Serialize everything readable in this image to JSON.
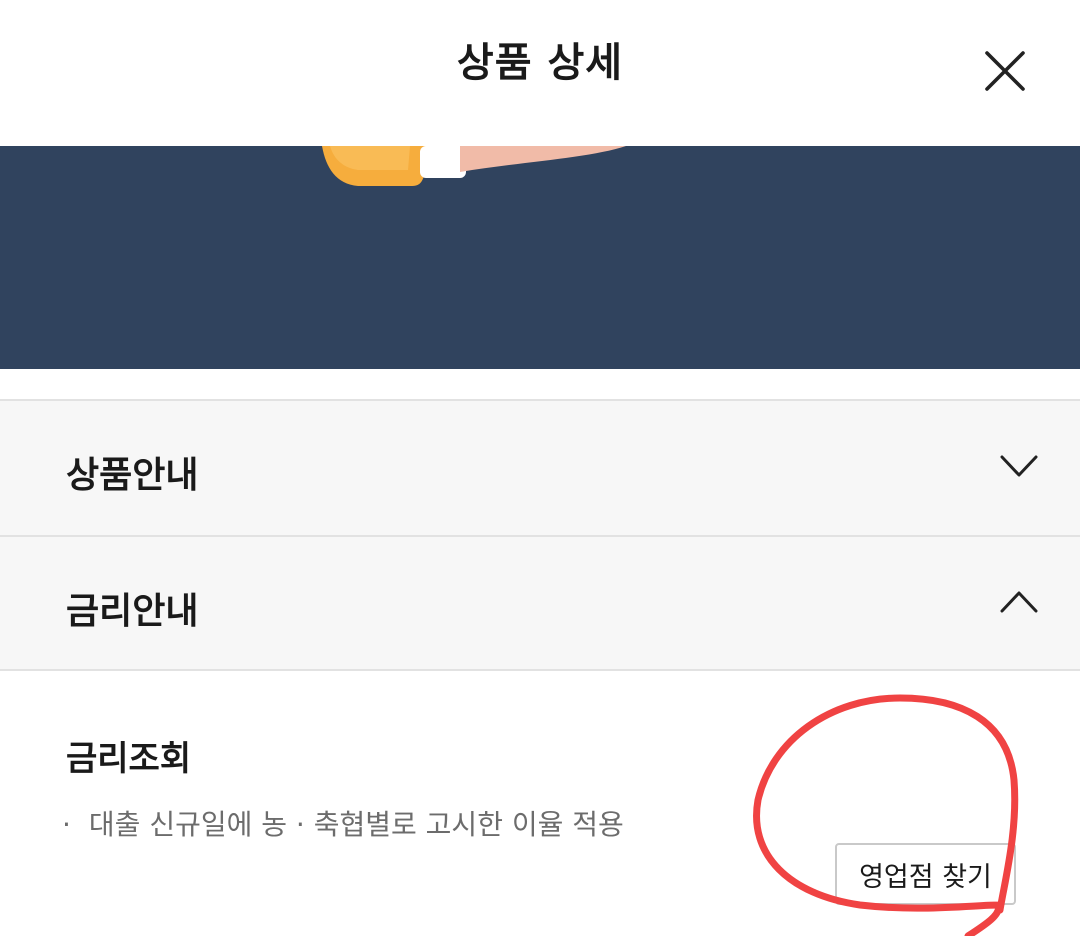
{
  "header": {
    "title": "상품 상세",
    "close_icon": "close-icon"
  },
  "banner": {
    "background": "#30435e",
    "illustration": "hand-illustration"
  },
  "accordion": [
    {
      "label": "상품안내",
      "state": "collapsed",
      "icon": "chevron-down-icon"
    },
    {
      "label": "금리안내",
      "state": "expanded",
      "icon": "chevron-up-icon"
    }
  ],
  "rate_section": {
    "title": "금리조회",
    "notes": [
      {
        "bullet": "·",
        "text": "대출 신규일에 농 · 축협별로 고시한 이율 적용"
      }
    ],
    "branch_button": "영업점 찾기"
  },
  "annotation": {
    "shape": "red-hand-drawn-circle",
    "color": "#f04343"
  }
}
